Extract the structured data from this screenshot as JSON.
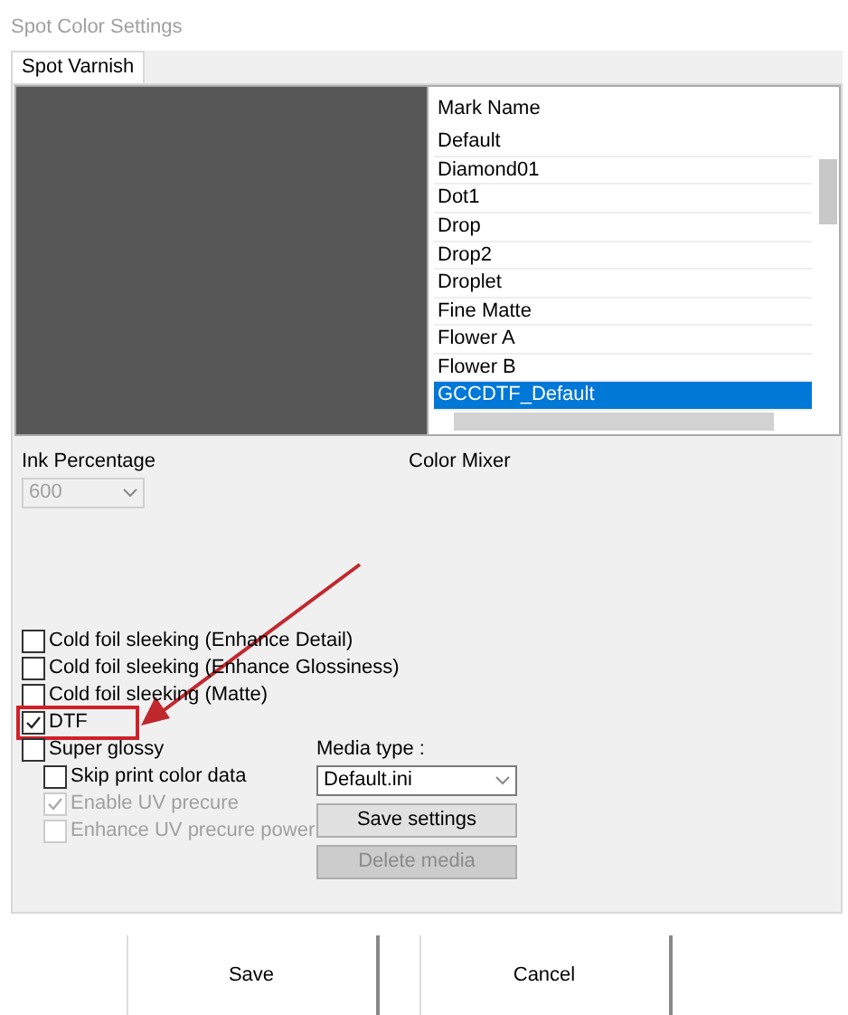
{
  "window": {
    "title": "Spot Color Settings"
  },
  "tabs": [
    {
      "label": "Spot Varnish",
      "selected": true
    }
  ],
  "mark_list": {
    "header": "Mark Name",
    "items": [
      {
        "label": "Default",
        "selected": false
      },
      {
        "label": "Diamond01",
        "selected": false
      },
      {
        "label": "Dot1",
        "selected": false
      },
      {
        "label": "Drop",
        "selected": false
      },
      {
        "label": "Drop2",
        "selected": false
      },
      {
        "label": "Droplet",
        "selected": false
      },
      {
        "label": "Fine Matte",
        "selected": false
      },
      {
        "label": "Flower A",
        "selected": false
      },
      {
        "label": "Flower B",
        "selected": false
      },
      {
        "label": "GCCDTF_Default",
        "selected": true
      }
    ]
  },
  "ink_percentage": {
    "label": "Ink Percentage",
    "value": "600",
    "disabled": true
  },
  "color_mixer": {
    "label": "Color Mixer"
  },
  "options": [
    {
      "label": "Cold foil sleeking (Enhance Detail)",
      "checked": false,
      "disabled": false,
      "highlighted": false
    },
    {
      "label": "Cold foil sleeking (Enhance Glossiness)",
      "checked": false,
      "disabled": false,
      "highlighted": false
    },
    {
      "label": "Cold foil sleeking (Matte)",
      "checked": false,
      "disabled": false,
      "highlighted": false
    },
    {
      "label": "DTF",
      "checked": true,
      "disabled": false,
      "highlighted": true
    },
    {
      "label": "Super glossy",
      "checked": false,
      "disabled": false,
      "highlighted": false,
      "children": [
        {
          "label": "Skip print color data",
          "checked": false,
          "disabled": false,
          "highlighted": false
        },
        {
          "label": "Enable UV precure",
          "checked": true,
          "disabled": true,
          "highlighted": false
        },
        {
          "label": "Enhance UV precure power",
          "checked": false,
          "disabled": true,
          "highlighted": false
        }
      ]
    }
  ],
  "media": {
    "label": "Media type :",
    "value": "Default.ini",
    "buttons": [
      {
        "label": "Save settings",
        "disabled": false
      },
      {
        "label": "Delete media",
        "disabled": true
      }
    ]
  },
  "footer_buttons": [
    {
      "label": "Save"
    },
    {
      "label": "Cancel"
    }
  ]
}
